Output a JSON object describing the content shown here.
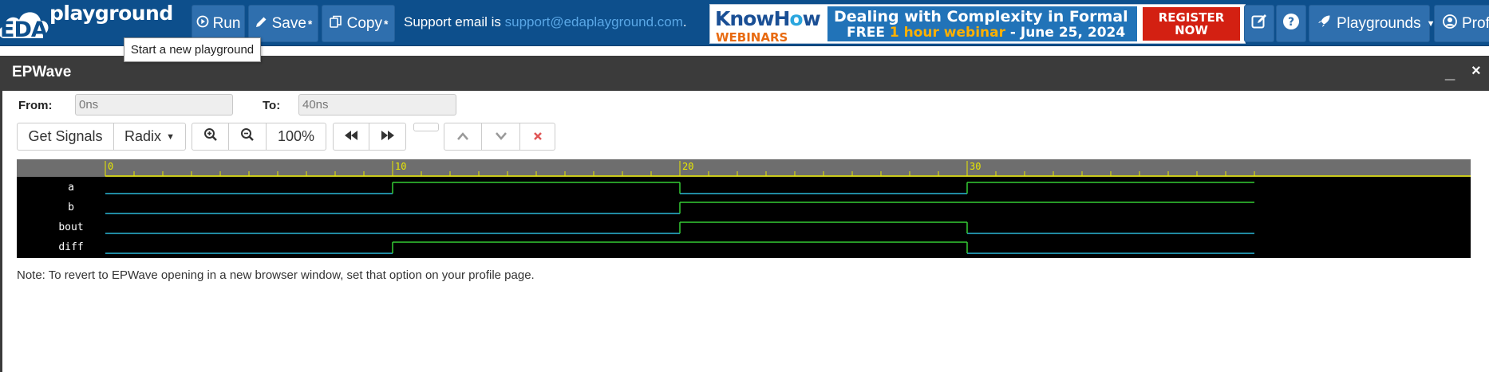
{
  "navbar": {
    "logo": {
      "prefix": "EDA",
      "name": "playground"
    },
    "buttons": {
      "run": "Run",
      "save": "Save",
      "copy": "Copy",
      "modified_marker": "*"
    },
    "support": {
      "text": "Support email is ",
      "email": "support@edaplayground.com",
      "suffix": "."
    },
    "banner": {
      "brand_know": "Know",
      "brand_h": "H",
      "brand_o": "o",
      "brand_w": "w",
      "brand_sub": "WEBINARS",
      "headline": "Dealing with Complexity in Formal",
      "line2_a": "FREE ",
      "line2_b": "1 hour webinar",
      "line2_c": " - June 25, 2024",
      "register": "REGISTER",
      "now": "NOW"
    },
    "playgrounds": "Playgrounds",
    "profile": "Profi"
  },
  "tooltip": "Start a new playground",
  "epwave": {
    "title": "EPWave",
    "minimize": "_",
    "close": "×",
    "from_label": "From:",
    "from_value": "0ns",
    "to_label": "To:",
    "to_value": "40ns",
    "toolbar": {
      "get_signals": "Get Signals",
      "radix": "Radix",
      "zoom": "100%"
    },
    "note": "Note: To revert to EPWave opening in a new browser window, set that option on your profile page."
  },
  "chart_data": {
    "type": "line",
    "title": "",
    "x_unit": "ns",
    "xlim": [
      0,
      40
    ],
    "ticks": [
      0,
      10,
      20,
      30
    ],
    "series": [
      {
        "name": "a",
        "values": [
          [
            0,
            0
          ],
          [
            10,
            1
          ],
          [
            20,
            0
          ],
          [
            30,
            1
          ]
        ]
      },
      {
        "name": "b",
        "values": [
          [
            0,
            0
          ],
          [
            20,
            1
          ]
        ]
      },
      {
        "name": "bout",
        "values": [
          [
            0,
            0
          ],
          [
            20,
            1
          ],
          [
            30,
            0
          ]
        ]
      },
      {
        "name": "diff",
        "values": [
          [
            0,
            0
          ],
          [
            10,
            1
          ],
          [
            30,
            0
          ]
        ]
      }
    ],
    "colors": {
      "low": "#2ab8d8",
      "high": "#34cc34",
      "ruler_bg": "#6e6e6e",
      "ruler_line": "#e8e800",
      "bg": "#000000"
    }
  }
}
